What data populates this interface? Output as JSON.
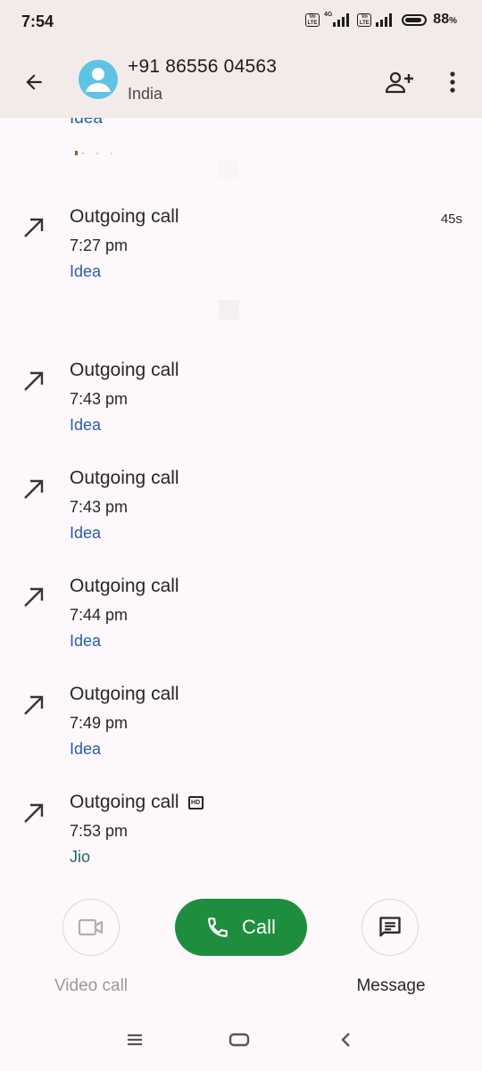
{
  "status_bar": {
    "time": "7:54",
    "volte_label": "Vo LTE",
    "network_label": "4G",
    "battery_level": 88,
    "battery_text": "88",
    "battery_unit": "%"
  },
  "header": {
    "back_icon": "arrow-back-icon",
    "avatar_icon": "person-icon",
    "avatar_color": "#5ec3e4",
    "contact_number": "+91 86556 04563",
    "contact_country": "India",
    "add_contact_icon": "person-add-icon",
    "more_icon": "more-vert-icon"
  },
  "call_history": {
    "partial_top_carrier": "Idea",
    "entries": [
      {
        "type": "Outgoing call",
        "time": "7:27 pm",
        "carrier": "Idea",
        "duration": "45s",
        "hd": false
      },
      {
        "type": "Outgoing call",
        "time": "7:43 pm",
        "carrier": "Idea",
        "duration": "",
        "hd": false
      },
      {
        "type": "Outgoing call",
        "time": "7:43 pm",
        "carrier": "Idea",
        "duration": "",
        "hd": false
      },
      {
        "type": "Outgoing call",
        "time": "7:44 pm",
        "carrier": "Idea",
        "duration": "",
        "hd": false
      },
      {
        "type": "Outgoing call",
        "time": "7:49 pm",
        "carrier": "Idea",
        "duration": "",
        "hd": false
      },
      {
        "type": "Outgoing call",
        "time": "7:53 pm",
        "carrier": "Jio",
        "duration": "",
        "hd": true
      }
    ],
    "hd_badge": "HD"
  },
  "actions": {
    "video_call_label": "Video call",
    "call_label": "Call",
    "message_label": "Message",
    "call_color": "#1e8e3e"
  },
  "nav_bar": {
    "menu_icon": "menu-icon",
    "home_icon": "home-icon",
    "back_icon": "back-chevron-icon"
  }
}
